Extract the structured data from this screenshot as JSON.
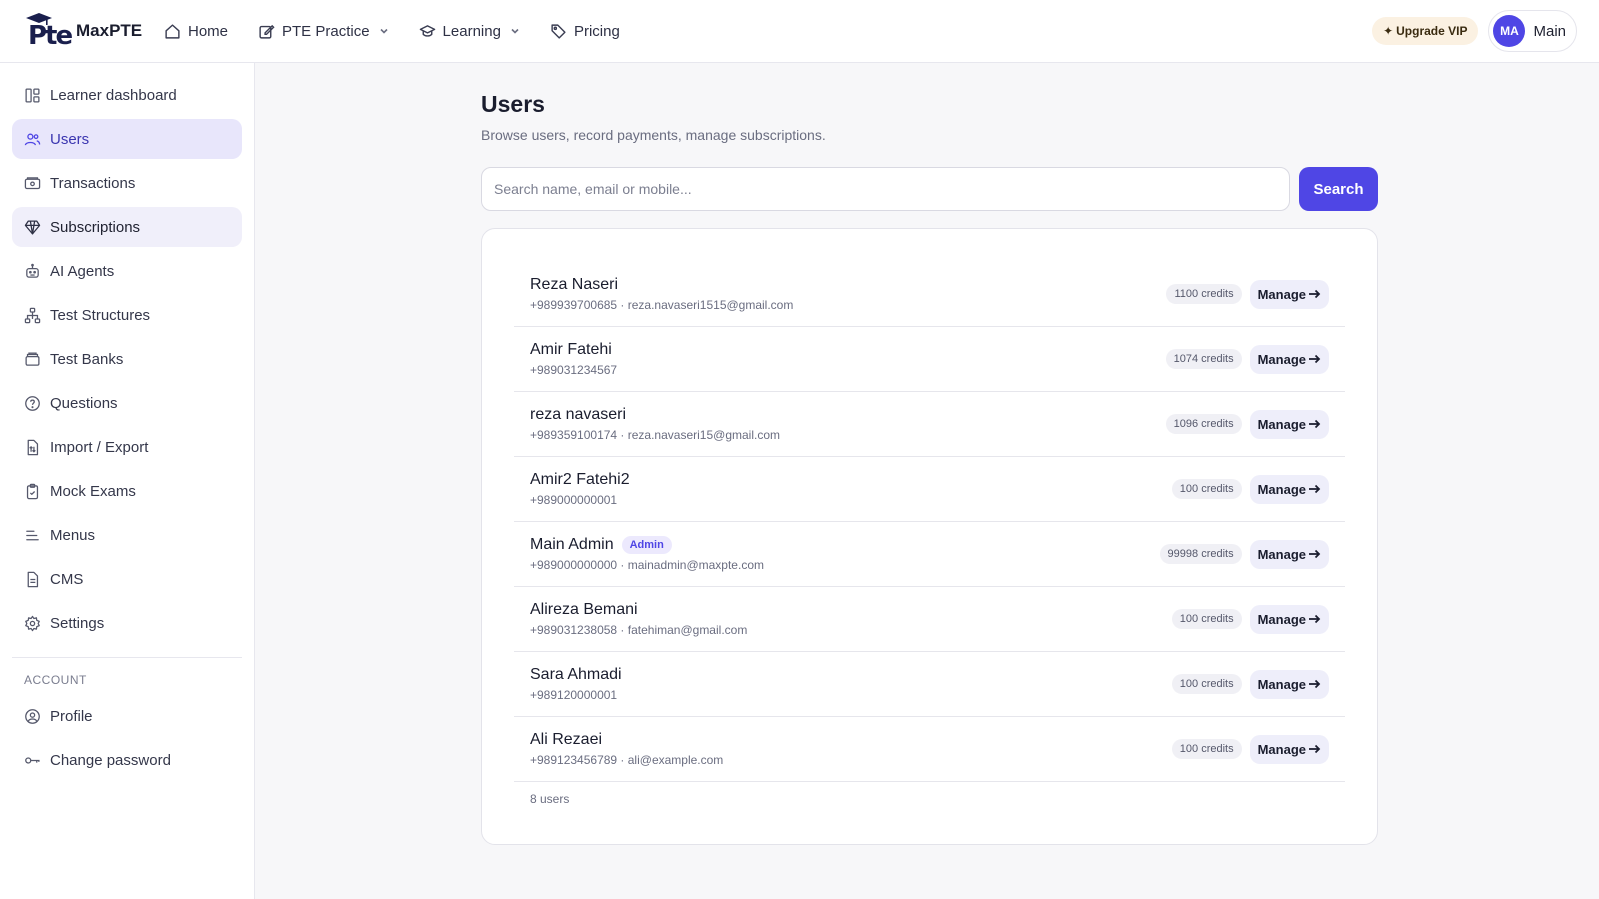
{
  "brand": {
    "logo_text": "Pte",
    "name": "MaxPTE"
  },
  "nav": [
    {
      "label": "Home",
      "icon": "home-icon"
    },
    {
      "label": "PTE Practice",
      "icon": "edit-icon",
      "dropdown": true
    },
    {
      "label": "Learning",
      "icon": "graduation-cap-icon",
      "dropdown": true
    },
    {
      "label": "Pricing",
      "icon": "tag-icon"
    }
  ],
  "top_right": {
    "vip_label": "Upgrade VIP",
    "avatar_initials": "MA",
    "user_label": "Main"
  },
  "sidebar": {
    "items": [
      {
        "label": "Learner dashboard",
        "icon": "dashboard-icon",
        "state": "normal"
      },
      {
        "label": "Users",
        "icon": "users-icon",
        "state": "active"
      },
      {
        "label": "Transactions",
        "icon": "cash-icon",
        "state": "normal"
      },
      {
        "label": "Subscriptions",
        "icon": "diamond-icon",
        "state": "soft"
      },
      {
        "label": "AI Agents",
        "icon": "robot-icon",
        "state": "normal"
      },
      {
        "label": "Test Structures",
        "icon": "hierarchy-icon",
        "state": "normal"
      },
      {
        "label": "Test Banks",
        "icon": "archive-icon",
        "state": "normal"
      },
      {
        "label": "Questions",
        "icon": "question-icon",
        "state": "normal"
      },
      {
        "label": "Import / Export",
        "icon": "file-transfer-icon",
        "state": "normal"
      },
      {
        "label": "Mock Exams",
        "icon": "clipboard-icon",
        "state": "normal"
      },
      {
        "label": "Menus",
        "icon": "menu-icon",
        "state": "normal"
      },
      {
        "label": "CMS",
        "icon": "document-icon",
        "state": "normal"
      },
      {
        "label": "Settings",
        "icon": "gear-icon",
        "state": "normal"
      }
    ],
    "account_section": "ACCOUNT",
    "account_items": [
      {
        "label": "Profile",
        "icon": "user-circle-icon"
      },
      {
        "label": "Change password",
        "icon": "key-icon"
      }
    ]
  },
  "main": {
    "title": "Users",
    "subtitle": "Browse users, record payments, manage subscriptions.",
    "search": {
      "placeholder": "Search name, email or mobile...",
      "value": "",
      "button_label": "Search"
    },
    "users": [
      {
        "name": "Reza Naseri",
        "meta": "+989939700685 · reza.navaseri1515@gmail.com",
        "credits": "1100 credits",
        "badge": ""
      },
      {
        "name": "Amir Fatehi",
        "meta": "+989031234567",
        "credits": "1074 credits",
        "badge": ""
      },
      {
        "name": "reza navaseri",
        "meta": "+989359100174 · reza.navaseri15@gmail.com",
        "credits": "1096 credits",
        "badge": ""
      },
      {
        "name": "Amir2 Fatehi2",
        "meta": "+989000000001",
        "credits": "100 credits",
        "badge": ""
      },
      {
        "name": "Main Admin",
        "meta": "+989000000000 · mainadmin@maxpte.com",
        "credits": "99998 credits",
        "badge": "Admin"
      },
      {
        "name": "Alireza Bemani",
        "meta": "+989031238058 · fatehiman@gmail.com",
        "credits": "100 credits",
        "badge": ""
      },
      {
        "name": "Sara Ahmadi",
        "meta": "+989120000001",
        "credits": "100 credits",
        "badge": ""
      },
      {
        "name": "Ali Rezaei",
        "meta": "+989123456789 · ali@example.com",
        "credits": "100 credits",
        "badge": ""
      }
    ],
    "manage_label": "Manage",
    "count_label": "8 users"
  },
  "colors": {
    "accent": "#4f46e5",
    "active_bg": "#e8e6fb",
    "vip_bg": "#fbf1e2"
  }
}
